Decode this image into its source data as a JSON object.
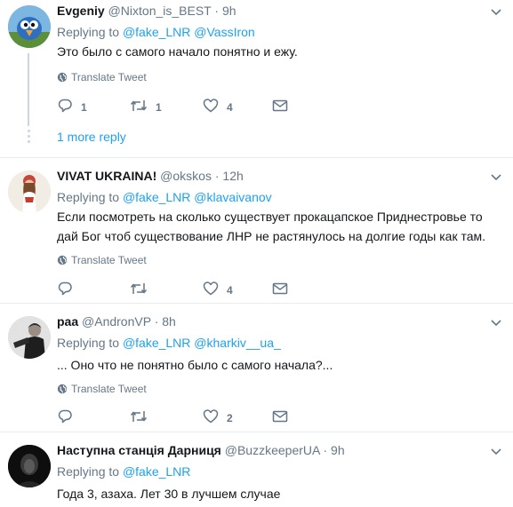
{
  "tweets": [
    {
      "name": "Evgeniy",
      "handle": "@Nixton_is_BEST",
      "dot": "·",
      "time": "9h",
      "replying_prefix": "Replying to ",
      "reply_users": [
        "@fake_LNR",
        "@VassIron"
      ],
      "text": "Это было с самого начало понятно и ежу.",
      "translate": "Translate Tweet",
      "replies": "1",
      "retweets": "1",
      "likes": "4",
      "more_reply": "1 more reply"
    },
    {
      "name": "VIVAT UKRAINA!",
      "handle": "@okskos",
      "dot": "·",
      "time": "12h",
      "replying_prefix": "Replying to ",
      "reply_users": [
        "@fake_LNR",
        "@klavaivanov"
      ],
      "text": "Если посмотреть на сколько существует прокацапское Приднестровье то дай Бог чтоб существование ЛНР не растянулось на долгие годы как там.",
      "translate": "Translate Tweet",
      "replies": "",
      "retweets": "",
      "likes": "4"
    },
    {
      "name": "paa",
      "handle": "@AndronVP",
      "dot": "·",
      "time": "8h",
      "replying_prefix": "Replying to ",
      "reply_users": [
        "@fake_LNR",
        "@kharkiv__ua_"
      ],
      "text": "... Оно что не понятно было с самого начала?...",
      "translate": "Translate Tweet",
      "replies": "",
      "retweets": "",
      "likes": "2"
    },
    {
      "name": "Наступна станція Дарниця",
      "handle": "@BuzzkeeperUA",
      "dot": "·",
      "time": "9h",
      "replying_prefix": "Replying to ",
      "reply_users": [
        "@fake_LNR"
      ],
      "text": "Года 3, азаха. Лет 30 в лучшем случае"
    }
  ],
  "colors": {
    "link": "#1da1f2",
    "muted": "#657786",
    "text": "#14171a",
    "border": "#e6ecf0"
  }
}
